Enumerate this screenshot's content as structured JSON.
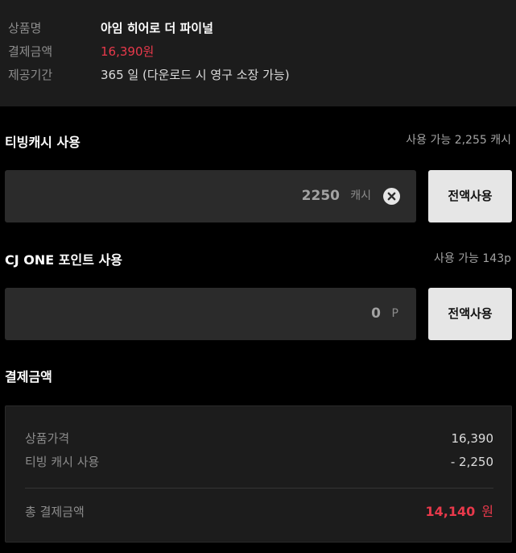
{
  "product_info": {
    "name_label": "상품명",
    "name_value": "아임 히어로 더 파이널",
    "price_label": "결제금액",
    "price_value": "16,390원",
    "period_label": "제공기간",
    "period_value": "365 일 (다운로드 시 영구 소장 가능)"
  },
  "tving_cash": {
    "title": "티빙캐시 사용",
    "available": "사용 가능 2,255 캐시",
    "amount": "2250",
    "unit": "캐시",
    "full_button": "전액사용"
  },
  "cj_point": {
    "title": "CJ ONE 포인트 사용",
    "available": "사용 가능 143p",
    "amount": "0",
    "unit": "P",
    "full_button": "전액사용"
  },
  "payment": {
    "title": "결제금액",
    "product_price_label": "상품가격",
    "product_price_value": "16,390",
    "cash_used_label": "티빙 캐시 사용",
    "cash_used_value": "- 2,250",
    "total_label": "총 결제금액",
    "total_value": "14,140",
    "total_unit": "원"
  },
  "colors": {
    "accent_red": "#e9394b",
    "background": "#000000",
    "panel": "#1c1c1c",
    "input": "#2b2b2b"
  },
  "icons": {
    "clear": "close-circle-icon"
  }
}
